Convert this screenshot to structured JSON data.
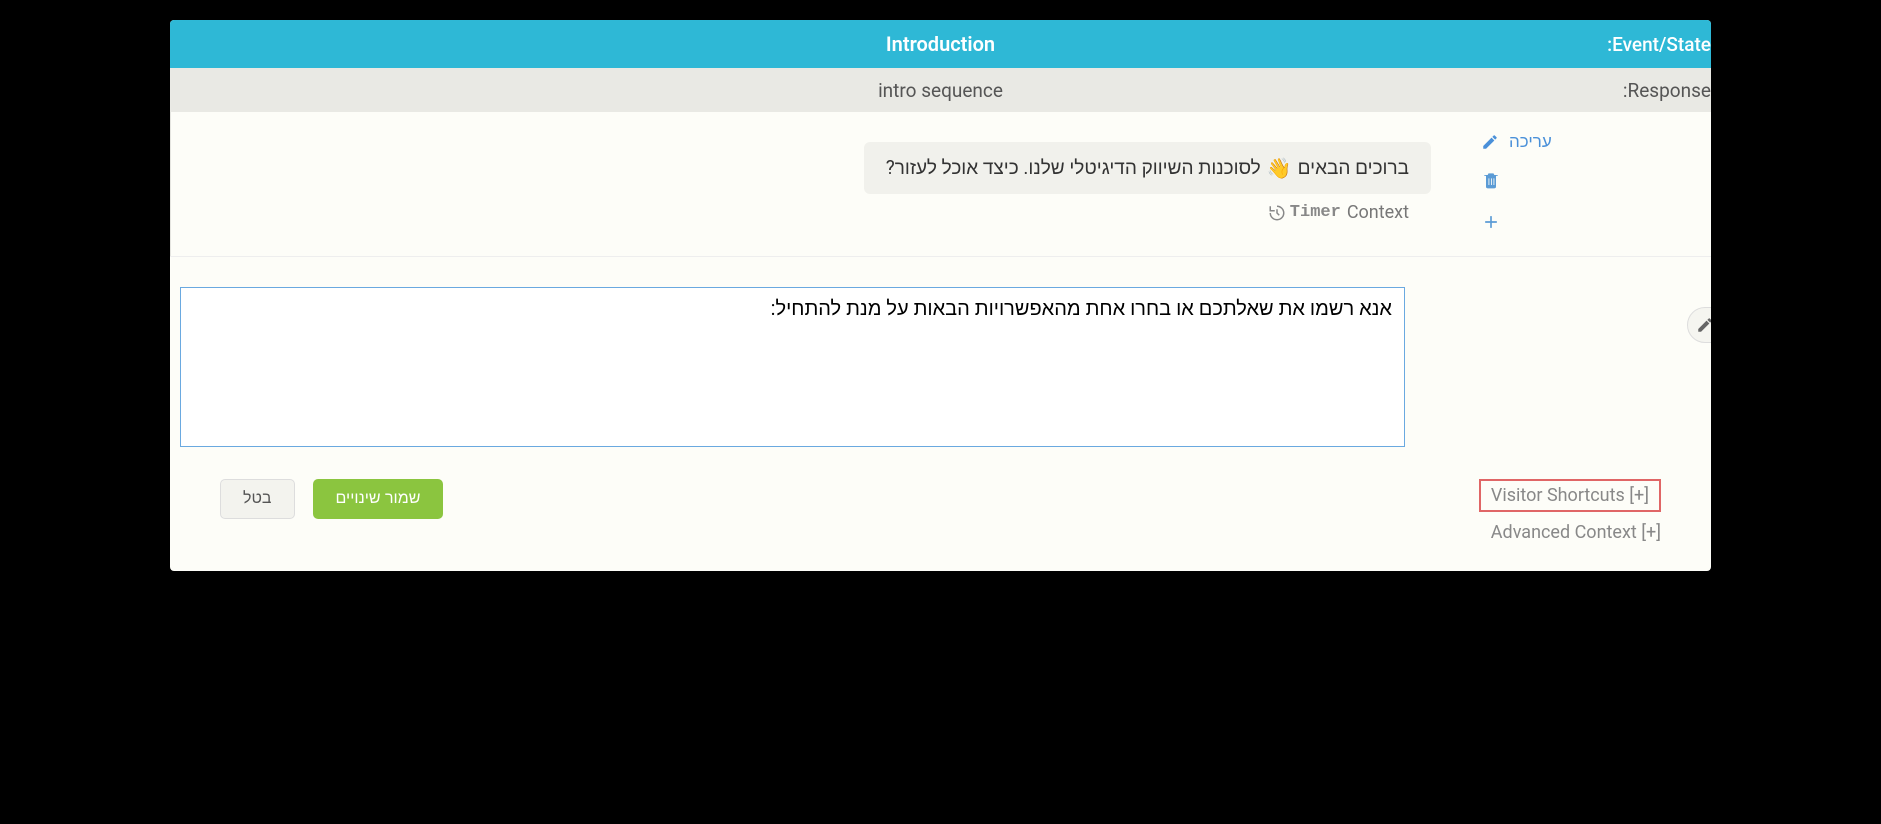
{
  "header": {
    "title": "Introduction",
    "right_label": ":Event/State"
  },
  "subheader": {
    "title": "intro sequence",
    "right_label": ":Response"
  },
  "message": {
    "text_before_emoji": "ברוכים הבאים",
    "emoji": "👋",
    "text_after_emoji": "לסוכנות השיווק הדיגיטלי שלנו. כיצד אוכל לעזור?"
  },
  "actions": {
    "edit_label": "עריכה"
  },
  "context": {
    "timer_label": "Timer",
    "context_label": "Context"
  },
  "editor": {
    "value": "אנא רשמו את שאלתכם או בחרו אחת מהאפשרויות הבאות על מנת להתחיל:"
  },
  "footer": {
    "cancel_label": "בטל",
    "save_label": "שמור שינויים",
    "visitor_shortcuts": "Visitor Shortcuts [+]",
    "advanced_context": "Advanced Context [+]"
  }
}
